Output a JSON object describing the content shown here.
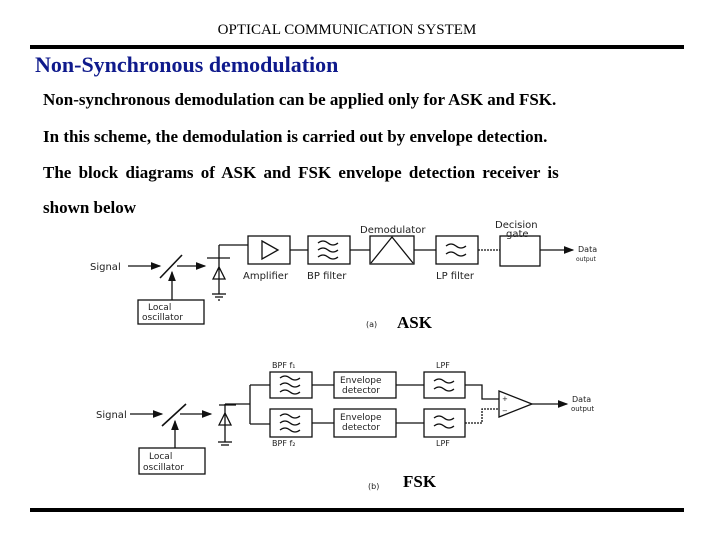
{
  "header": {
    "title": "OPTICAL COMMUNICATION SYSTEM"
  },
  "slide": {
    "title": "Non-Synchronous demodulation",
    "paragraphs": [
      "Non-synchronous demodulation can be applied only for ASK and FSK.",
      "In this scheme, the demodulation is carried out by envelope detection.",
      "The block diagrams of ASK and FSK envelope detection receiver is",
      "shown below"
    ]
  },
  "diagram_ask": {
    "signal_label": "Signal",
    "local_oscillator_line1": "Local",
    "local_oscillator_line2": "oscillator",
    "amplifier_label": "Amplifier",
    "bp_filter_label": "BP filter",
    "demodulator_label": "Demodulator",
    "lp_filter_label": "LP filter",
    "decision_gate_line1": "Decision",
    "decision_gate_line2": "gate",
    "data_output_line1": "Data",
    "data_output_line2": "output",
    "figure_tag": "(a)",
    "caption": "ASK"
  },
  "diagram_fsk": {
    "signal_label": "Signal",
    "local_oscillator_line1": "Local",
    "local_oscillator_line2": "oscillator",
    "bpf1_label": "BPF f₁",
    "bpf2_label": "BPF f₂",
    "envelope_detector_line1": "Envelope",
    "envelope_detector_line2": "detector",
    "lpf_label": "LPF",
    "comparator_plus": "+",
    "comparator_minus": "−",
    "data_output_line1": "Data",
    "data_output_line2": "output",
    "figure_tag": "(b)",
    "caption": "FSK"
  }
}
